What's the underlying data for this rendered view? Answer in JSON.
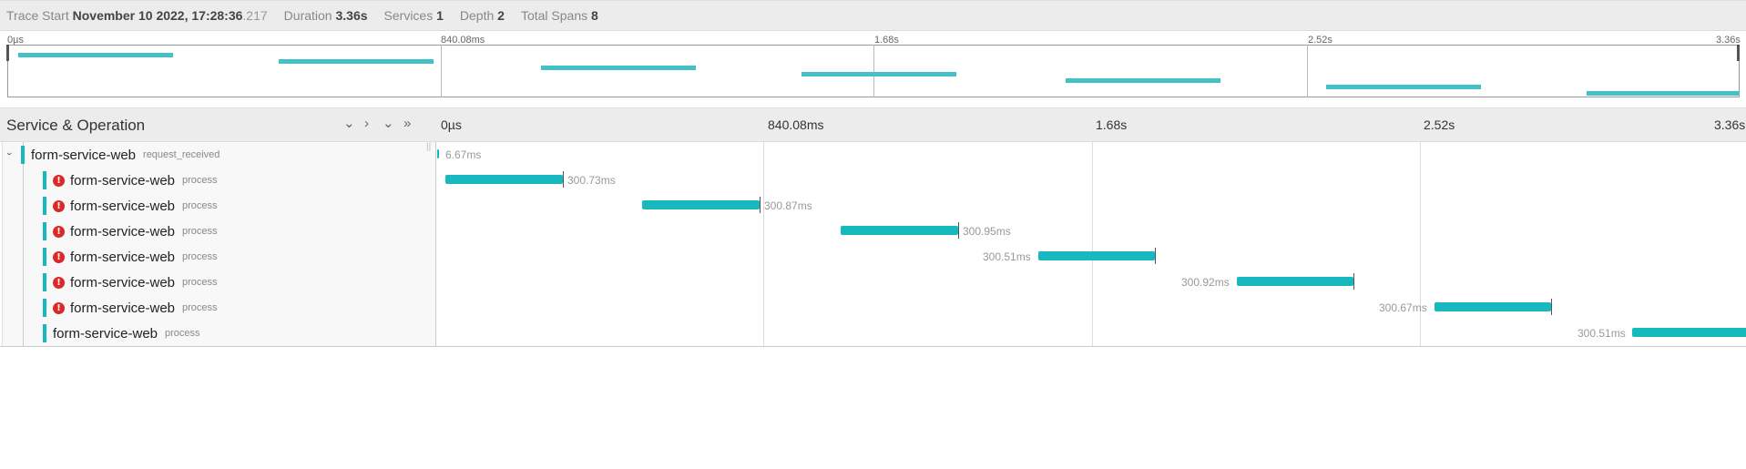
{
  "header": {
    "trace_start_label": "Trace Start",
    "trace_start_value": "November 10 2022, 17:28:36",
    "trace_start_ms": ".217",
    "duration_label": "Duration",
    "duration_value": "3.36s",
    "services_label": "Services",
    "services_value": "1",
    "depth_label": "Depth",
    "depth_value": "2",
    "total_spans_label": "Total Spans",
    "total_spans_value": "8"
  },
  "minimap": {
    "ticks": [
      "0µs",
      "840.08ms",
      "1.68s",
      "2.52s",
      "3.36s"
    ]
  },
  "timeline": {
    "title": "Service & Operation",
    "ticks": [
      "0µs",
      "840.08ms",
      "1.68s",
      "2.52s",
      "3.36s"
    ]
  },
  "spans": [
    {
      "service": "form-service-web",
      "operation": "request_received",
      "duration": "6.67ms",
      "error": false
    },
    {
      "service": "form-service-web",
      "operation": "process",
      "duration": "300.73ms",
      "error": true
    },
    {
      "service": "form-service-web",
      "operation": "process",
      "duration": "300.87ms",
      "error": true
    },
    {
      "service": "form-service-web",
      "operation": "process",
      "duration": "300.95ms",
      "error": true
    },
    {
      "service": "form-service-web",
      "operation": "process",
      "duration": "300.51ms",
      "error": true
    },
    {
      "service": "form-service-web",
      "operation": "process",
      "duration": "300.92ms",
      "error": true
    },
    {
      "service": "form-service-web",
      "operation": "process",
      "duration": "300.67ms",
      "error": true
    },
    {
      "service": "form-service-web",
      "operation": "process",
      "duration": "300.51ms",
      "error": false
    }
  ],
  "colors": {
    "span_teal": "#17b8be",
    "minimap_teal": "#44c1c7",
    "error_red": "#db2828"
  }
}
